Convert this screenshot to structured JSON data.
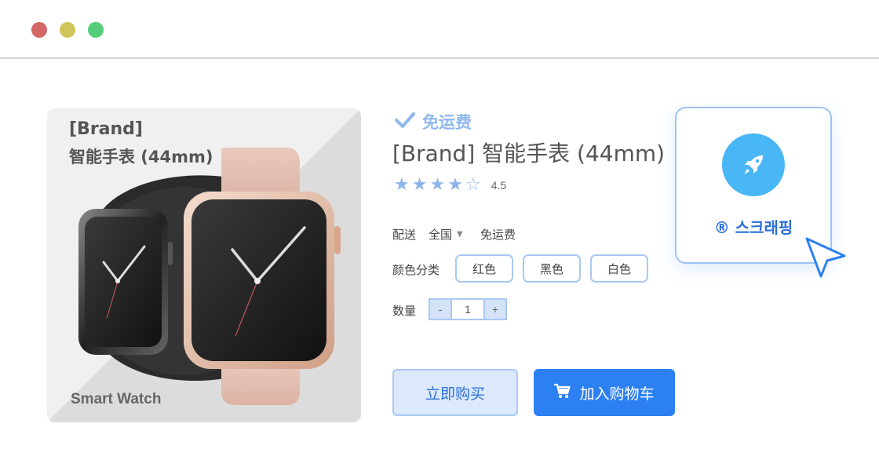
{
  "window": {
    "controls": [
      "close",
      "minimize",
      "maximize"
    ]
  },
  "product_image": {
    "brand": "[Brand]",
    "title": "智能手表 (44mm)",
    "caption": "Smart Watch"
  },
  "product": {
    "free_shipping_badge": "免运费",
    "title": "[Brand] 智能手表 (44mm)",
    "rating": {
      "stars": [
        "★",
        "★",
        "★",
        "★",
        "☆"
      ],
      "value": "4.5"
    },
    "shipping": {
      "label": "配送",
      "region": "全国",
      "fee": "免运费"
    },
    "color": {
      "label": "颜色分类",
      "options": [
        "红色",
        "黑色",
        "白色"
      ]
    },
    "quantity": {
      "label": "数量",
      "minus": "-",
      "value": "1",
      "plus": "+"
    },
    "buy_now_label": "立即购买",
    "add_to_cart_label": "加入购物车"
  },
  "scraper": {
    "label": "® 스크래핑",
    "icon": "rocket-icon"
  },
  "colors": {
    "accent": "#2d80f2",
    "light_accent": "#a9c8f3",
    "badge": "#8fb8ef",
    "rocket_bg": "#49b6f6"
  }
}
